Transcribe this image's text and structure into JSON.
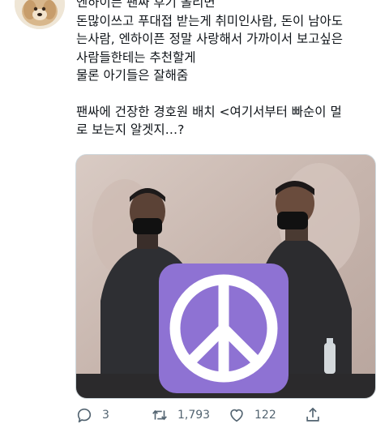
{
  "tweet": {
    "lines_group_1": [
      "엔하이픈 팬싸 후기 올리면",
      "돈많이쓰고 푸대접 받는게 취미인사람, 돈이 남아도",
      "는사람, 엔하이픈 정말 사랑해서 가까이서 보고싶은",
      "사람들한테는 추천할게",
      "물론 아기들은 잘해줌"
    ],
    "lines_group_2": [
      "팬싸에 건장한 경호원 배치 <여기서부터 빠순이 멀",
      "로 보는지 알겟지…?"
    ]
  },
  "media": {
    "overlay_icon": "peace-symbol-icon",
    "overlay_color": "#8e72d3"
  },
  "actions": {
    "reply": {
      "icon": "reply-icon",
      "count": "3"
    },
    "retweet": {
      "icon": "retweet-icon",
      "count": "1,793"
    },
    "like": {
      "icon": "heart-icon",
      "count": "122"
    },
    "share": {
      "icon": "share-icon"
    }
  }
}
